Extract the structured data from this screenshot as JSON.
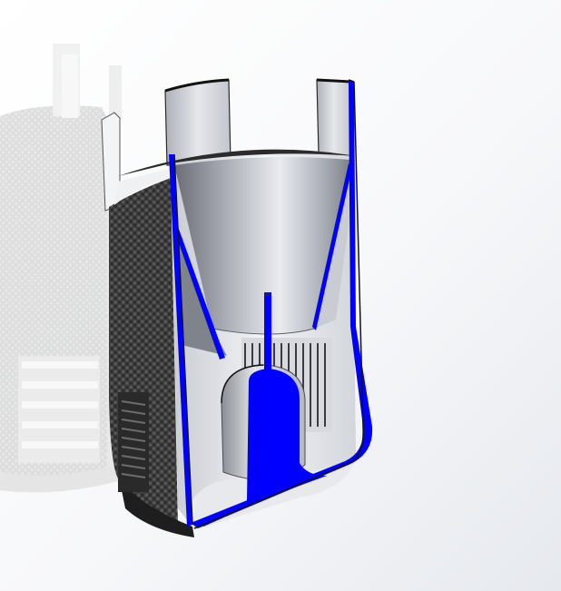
{
  "viewport": {
    "background_top": "#ffffff",
    "background_bottom": "#e3e7ee",
    "ghost_color": "#d6d6d6",
    "carbon_color": "#3a3a3a",
    "section_color": "#0000ff",
    "interior_shade": "#9a9ea8",
    "interior_light": "#eef0f4"
  }
}
